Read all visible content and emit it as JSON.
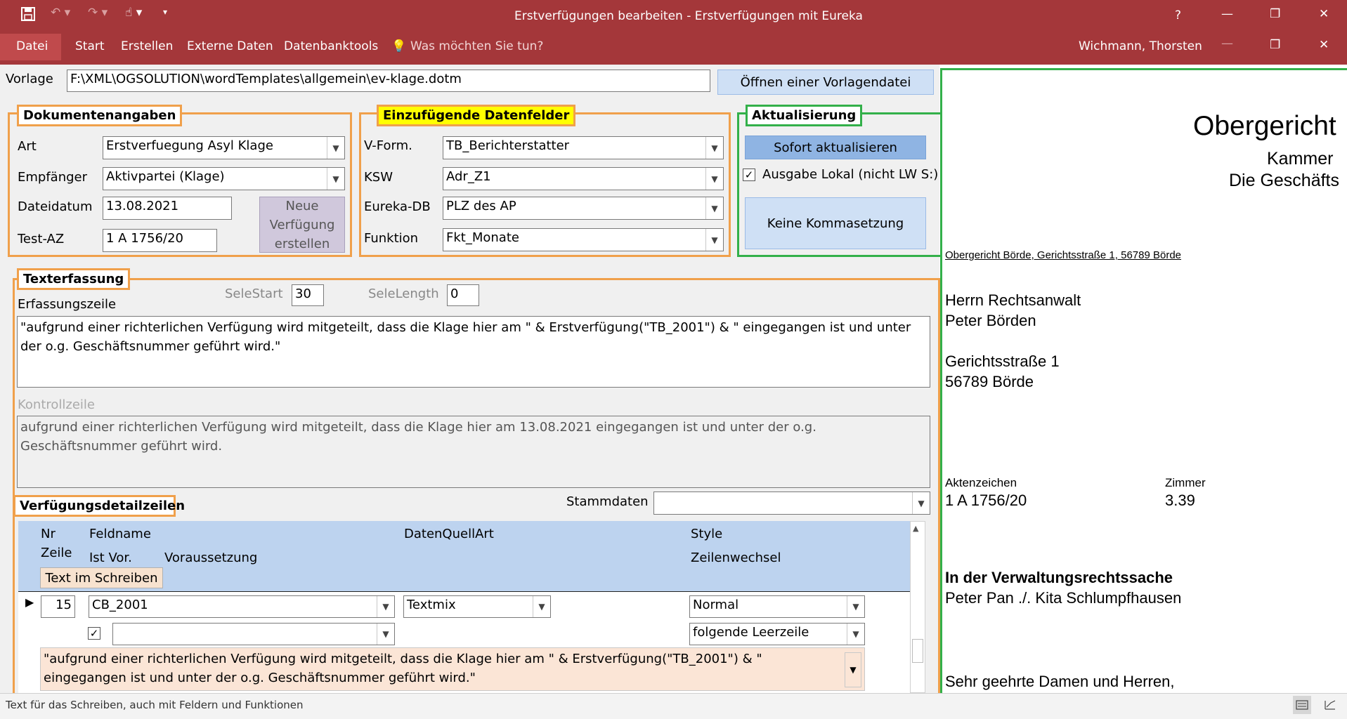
{
  "window": {
    "title": "Erstverfügungen bearbeiten - Erstverfügungen mit Eureka",
    "help": "?",
    "minimize": "—",
    "restore": "❐",
    "close": "✕",
    "user": "Wichmann, Thorsten"
  },
  "ribbon": {
    "tabs": [
      "Datei",
      "Start",
      "Erstellen",
      "Externe Daten",
      "Datenbanktools"
    ],
    "tell_me": "Was möchten Sie tun?"
  },
  "vorlage": {
    "label": "Vorlage",
    "path": "F:\\XML\\OGSOLUTION\\wordTemplates\\allgemein\\ev-klage.dotm",
    "open_button": "Öffnen einer Vorlagendatei"
  },
  "dokumentenangaben": {
    "title": "Dokumentenangaben",
    "art_label": "Art",
    "art_value": "Erstverfuegung Asyl Klage",
    "empfaenger_label": "Empfänger",
    "empfaenger_value": "Aktivpartei (Klage)",
    "dateidatum_label": "Dateidatum",
    "dateidatum_value": "13.08.2021",
    "testaz_label": "Test-AZ",
    "testaz_value": "1 A 1756/20",
    "neue_button_l1": "Neue",
    "neue_button_l2": "Verfügung",
    "neue_button_l3": "erstellen"
  },
  "datenfelder": {
    "title": "Einzufügende Datenfelder",
    "vform_label": "V-Form.",
    "vform_value": "TB_Berichterstatter",
    "ksw_label": "KSW",
    "ksw_value": "Adr_Z1",
    "eureka_label": "Eureka-DB",
    "eureka_value": "PLZ des AP",
    "funktion_label": "Funktion",
    "funktion_value": "Fkt_Monate"
  },
  "aktualisierung": {
    "title": "Aktualisierung",
    "sofort_button": "Sofort aktualisieren",
    "ausgabe_check": "✓",
    "ausgabe_label": "Ausgabe Lokal (nicht LW S:)",
    "komma_button": "Keine Kommasetzung"
  },
  "texterfassung": {
    "title": "Texterfassung",
    "selestart_label": "SeleStart",
    "selestart_value": "30",
    "selelength_label": "SeleLength",
    "selelength_value": "0",
    "erfassung_label": "Erfassungszeile",
    "erfassung_line1": "\"aufgrund einer richterlichen Verfügung wird mitgeteilt, dass die Klage hier am \" & Erstverfügung(\"TB_2001\") & \" eingegangen ist und unter",
    "erfassung_line2": "der o.g. Geschäftsnummer geführt wird.\"",
    "kontroll_label": "Kontrollzeile",
    "kontroll_line1": "aufgrund einer richterlichen Verfügung wird mitgeteilt, dass die Klage hier am 13.08.2021  eingegangen ist und unter der o.g.",
    "kontroll_line2": "Geschäftsnummer geführt wird."
  },
  "detail": {
    "title": "Verfügungsdetailzeilen",
    "stammdaten_label": "Stammdaten",
    "stammdaten_value": "",
    "headers": {
      "nr": "Nr",
      "zeile": "Zeile",
      "feldname": "Feldname",
      "istvor": "Ist Vor.",
      "voraussetzung": "Voraussetzung",
      "datenquellart": "DatenQuellArt",
      "style": "Style",
      "zeilenwechsel": "Zeilenwechsel",
      "text_button": "Text im Schreiben"
    },
    "row": {
      "selector": "▶",
      "nr": "15",
      "feldname": "CB_2001",
      "datenquellart": "Textmix",
      "style": "Normal",
      "istvor": "✓",
      "voraussetzung": "",
      "zeilenwechsel": "folgende Leerzeile",
      "text_line1": "\"aufgrund einer richterlichen Verfügung wird mitgeteilt, dass die Klage hier am \" & Erstverfügung(\"TB_2001\") & \"",
      "text_line2": "eingegangen ist und unter der o.g. Geschäftsnummer geführt wird.\""
    }
  },
  "status": {
    "text": "Text für das Schreiben, auch mit Feldern und Funktionen"
  },
  "preview": {
    "court_title": "Obergericht",
    "kammer": "Kammer",
    "geschaeft": "Die Geschäfts",
    "sender_line": "Obergericht Börde, Gerichtsstraße 1, 56789 Börde",
    "addr1": "Herrn Rechtsanwalt",
    "addr2": "Peter Börden",
    "addr3": "Gerichtsstraße 1",
    "addr4": "56789 Börde",
    "az_label": "Aktenzeichen",
    "az_value": "1 A 1756/20",
    "zimmer_label": "Zimmer",
    "zimmer_value": "3.39",
    "sache": "In der Verwaltungsrechtssache",
    "parteien": "Peter Pan ./. Kita Schlumpfhausen",
    "anrede": "Sehr geehrte Damen und Herren,"
  }
}
